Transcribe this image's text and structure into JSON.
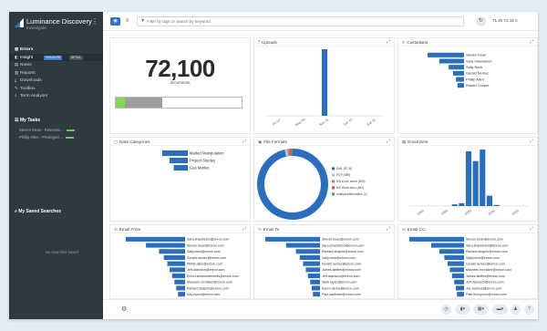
{
  "app": {
    "name": "Luminance Discovery",
    "subtitle": "Investigate"
  },
  "nav": [
    {
      "label": "Errors",
      "icon": "grid-icon",
      "bold": true
    },
    {
      "label": "Insight",
      "icon": "insight-icon",
      "active": true,
      "chips": [
        "VISUALISE",
        "DETAIL"
      ]
    },
    {
      "label": "Notes",
      "icon": "notes-icon"
    },
    {
      "label": "Reports",
      "icon": "reports-icon"
    },
    {
      "label": "Downloads",
      "icon": "download-icon"
    },
    {
      "label": "Toolbox",
      "icon": "toolbox-icon"
    },
    {
      "label": "Term Analyser",
      "icon": "search-icon"
    }
  ],
  "tasks": {
    "header": "My Tasks",
    "items": [
      "Steven Kean - Relevanc...",
      "Phillip Allen - Privileged ..."
    ]
  },
  "saved_searches": {
    "header": "My Saved Searches",
    "empty": "No searches saved"
  },
  "toolbar": {
    "search_placeholder": "Filter by tags or search by keyword",
    "stats": "71.2k 72.1k 0"
  },
  "documents_panel": {
    "count": "72,100",
    "label": "documents",
    "green_fraction": 0.07,
    "grey_fraction": 0.3
  },
  "panels": {
    "uploads": "Uploads",
    "custodians": "Custodians",
    "note_categories": "Note Categories",
    "file_formats": "File Formats",
    "email_sent": "Email Sent",
    "email_from": "Email From",
    "email_to": "Email To",
    "email_cc": "Email CC"
  },
  "colors": {
    "bar": "#2a6fbd",
    "accent": "#2f73c9",
    "sidebar": "#2f3a3e"
  },
  "charts": {
    "uploads": {
      "type": "bar",
      "x_ticks": [
        "Fri 07",
        "May 09",
        "Sun 11",
        "Tue 13",
        "Sat 15"
      ],
      "values": [
        0,
        0,
        0,
        0,
        0,
        0,
        0,
        0,
        72100,
        0,
        0,
        0,
        0,
        0,
        0,
        0,
        0
      ]
    },
    "custodians": {
      "type": "hbar",
      "categories": [
        "Steven Kean",
        "Sara Shackleton",
        "Sally Beck",
        "Gerald Nemec",
        "Phillip Allen",
        "Robert Cooper"
      ],
      "values": [
        100,
        68,
        42,
        30,
        22,
        18
      ]
    },
    "note_categories": {
      "type": "hbar",
      "categories": [
        "Market Manipulation",
        "Project Stanley",
        "Gas Market"
      ],
      "values": [
        100,
        72,
        55
      ]
    },
    "file_formats": {
      "type": "pie",
      "slices": [
        {
          "label": "EML (RT-B)",
          "value": 96,
          "color": "#2a6fbd"
        },
        {
          "label": "PDF (989)",
          "value": 1.2,
          "color": "#a8c8ec"
        },
        {
          "label": "MS Excel sheet (890)",
          "value": 1,
          "color": "#e57335"
        },
        {
          "label": "MS Word docx (462)",
          "value": 0.8,
          "color": "#c94e5a"
        },
        {
          "label": "multipart/alternative (2)",
          "value": 0.6,
          "color": "#4c9e6b"
        }
      ]
    },
    "email_sent": {
      "type": "bar",
      "x_ticks": [
        "1995",
        "1999",
        "2000",
        "2002",
        "2005"
      ],
      "values": [
        0,
        0,
        0,
        0,
        0,
        0,
        3,
        5,
        95,
        78,
        98,
        18,
        2,
        0,
        0,
        0,
        0
      ]
    },
    "email_from": {
      "type": "hbar",
      "categories": [
        "Sara.shackleton@enron.com",
        "Steven.kean@enron.com",
        "Sally.beck@enron.com",
        "Gerald.nemec@enron.com",
        "Phillip.allen@enron.com",
        "Jeff.dasovich@enron.com",
        "Enron.announcements@enron.com",
        "Maureen.mcvicker@enron.com",
        "Richard.shapiro@enron.com",
        "Kay.mann@enron.com"
      ],
      "values": [
        100,
        66,
        44,
        36,
        30,
        26,
        22,
        18,
        15,
        12
      ]
    },
    "email_to": {
      "type": "hbar",
      "categories": [
        "Steven.kean@enron.com",
        "Sara.shackleton@enron.com",
        "Richard.shapiro@enron.com",
        "Sally.beck@enron.com",
        "Gerald.nemec@enron.com",
        "James.steffes@enron.com",
        "Jeff.dasovich@enron.com",
        "Mark.taylor@enron.com",
        "Karen.denne@enron.com",
        "Paul.kaufman@enron.com"
      ],
      "values": [
        100,
        62,
        44,
        37,
        31,
        26,
        22,
        18,
        15,
        13
      ]
    },
    "email_cc": {
      "type": "hbar",
      "categories": [
        "Steven.kean@enron.com",
        "Sara.shackleton@enron.com",
        "Richard.shapiro@enron.com",
        "Sally.beck@enron.com",
        "Gerald.nemec@enron.com",
        "Maureen.mcvicker@enron.com",
        "James.steffes@enron.com",
        "Jeff.dasovich@enron.com",
        "Joe.hartsoe@enron.com",
        "Patti.thompson@enron.com"
      ],
      "values": [
        100,
        60,
        45,
        36,
        30,
        26,
        22,
        18,
        15,
        13
      ]
    }
  }
}
